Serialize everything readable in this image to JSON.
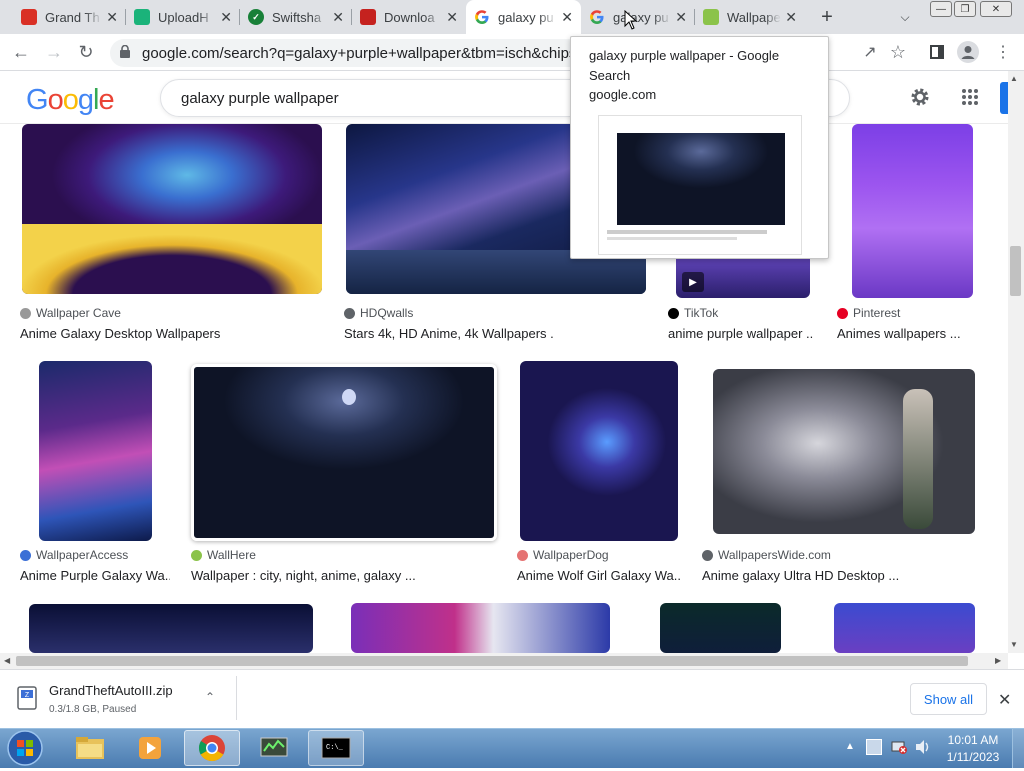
{
  "tabs": [
    {
      "title": "Grand Th",
      "favicon": "puzzle-red-icon",
      "color": "#d93025"
    },
    {
      "title": "UploadH",
      "favicon": "uploadhaven-icon",
      "color": "#1bb37a"
    },
    {
      "title": "Swiftsha",
      "favicon": "swiftshader-check-icon",
      "color": "#188038"
    },
    {
      "title": "Downloa",
      "favicon": "download-red-icon",
      "color": "#c5221f"
    },
    {
      "title": "galaxy pu",
      "favicon": "google-g-icon",
      "color": "#4285f4",
      "active": true
    },
    {
      "title": "galaxy pu",
      "favicon": "google-g-icon",
      "color": "#4285f4"
    },
    {
      "title": "Wallpape",
      "favicon": "wallhere-icon",
      "color": "#8bc34a"
    }
  ],
  "address_bar": {
    "url": "google.com/search?q=galaxy+purple+wallpaper&tbm=isch&chips=q:galaxy+purple+wallpaper,online_chips:anime+galaxy&hl=en&sa=X&ved=2ahUKEwd..."
  },
  "google": {
    "logo_text": "Google",
    "query": "galaxy purple wallpaper"
  },
  "tooltip": {
    "title": "galaxy purple wallpaper - Google Search",
    "domain": "google.com"
  },
  "results": [
    {
      "source": "Wallpaper Cave",
      "caption": "Anime Galaxy Desktop Wallpapers ...",
      "icon_color": "#999999"
    },
    {
      "source": "HDQwalls",
      "caption": "Stars 4k, HD Anime, 4k Wallpapers ...",
      "icon_color": "#5f6368"
    },
    {
      "source": "TikTok",
      "caption": "anime purple wallpaper ...",
      "icon_color": "#000000"
    },
    {
      "source": "Pinterest",
      "caption": "Animes wallpapers ...",
      "icon_color": "#e60023"
    },
    {
      "source": "WallpaperAccess",
      "caption": "Anime Purple Galaxy Wa...",
      "icon_color": "#3b6fd6"
    },
    {
      "source": "WallHere",
      "caption": "Wallpaper : city, night, anime, galaxy ...",
      "icon_color": "#8bc34a"
    },
    {
      "source": "WallpaperDog",
      "caption": "Anime Wolf Girl Galaxy Wa...",
      "icon_color": "#e57373"
    },
    {
      "source": "WallpapersWide.com",
      "caption": "Anime galaxy Ultra HD Desktop ...",
      "icon_color": "#5f6368"
    }
  ],
  "download": {
    "filename": "GrandTheftAutoIII.zip",
    "status": "0.3/1.8 GB, Paused",
    "show_all": "Show all"
  },
  "taskbar": {
    "time": "10:01 AM",
    "date": "1/11/2023"
  },
  "colors": {
    "google_blue": "#4285F4",
    "google_red": "#EA4335",
    "google_yellow": "#FBBC05",
    "google_green": "#34A853"
  }
}
